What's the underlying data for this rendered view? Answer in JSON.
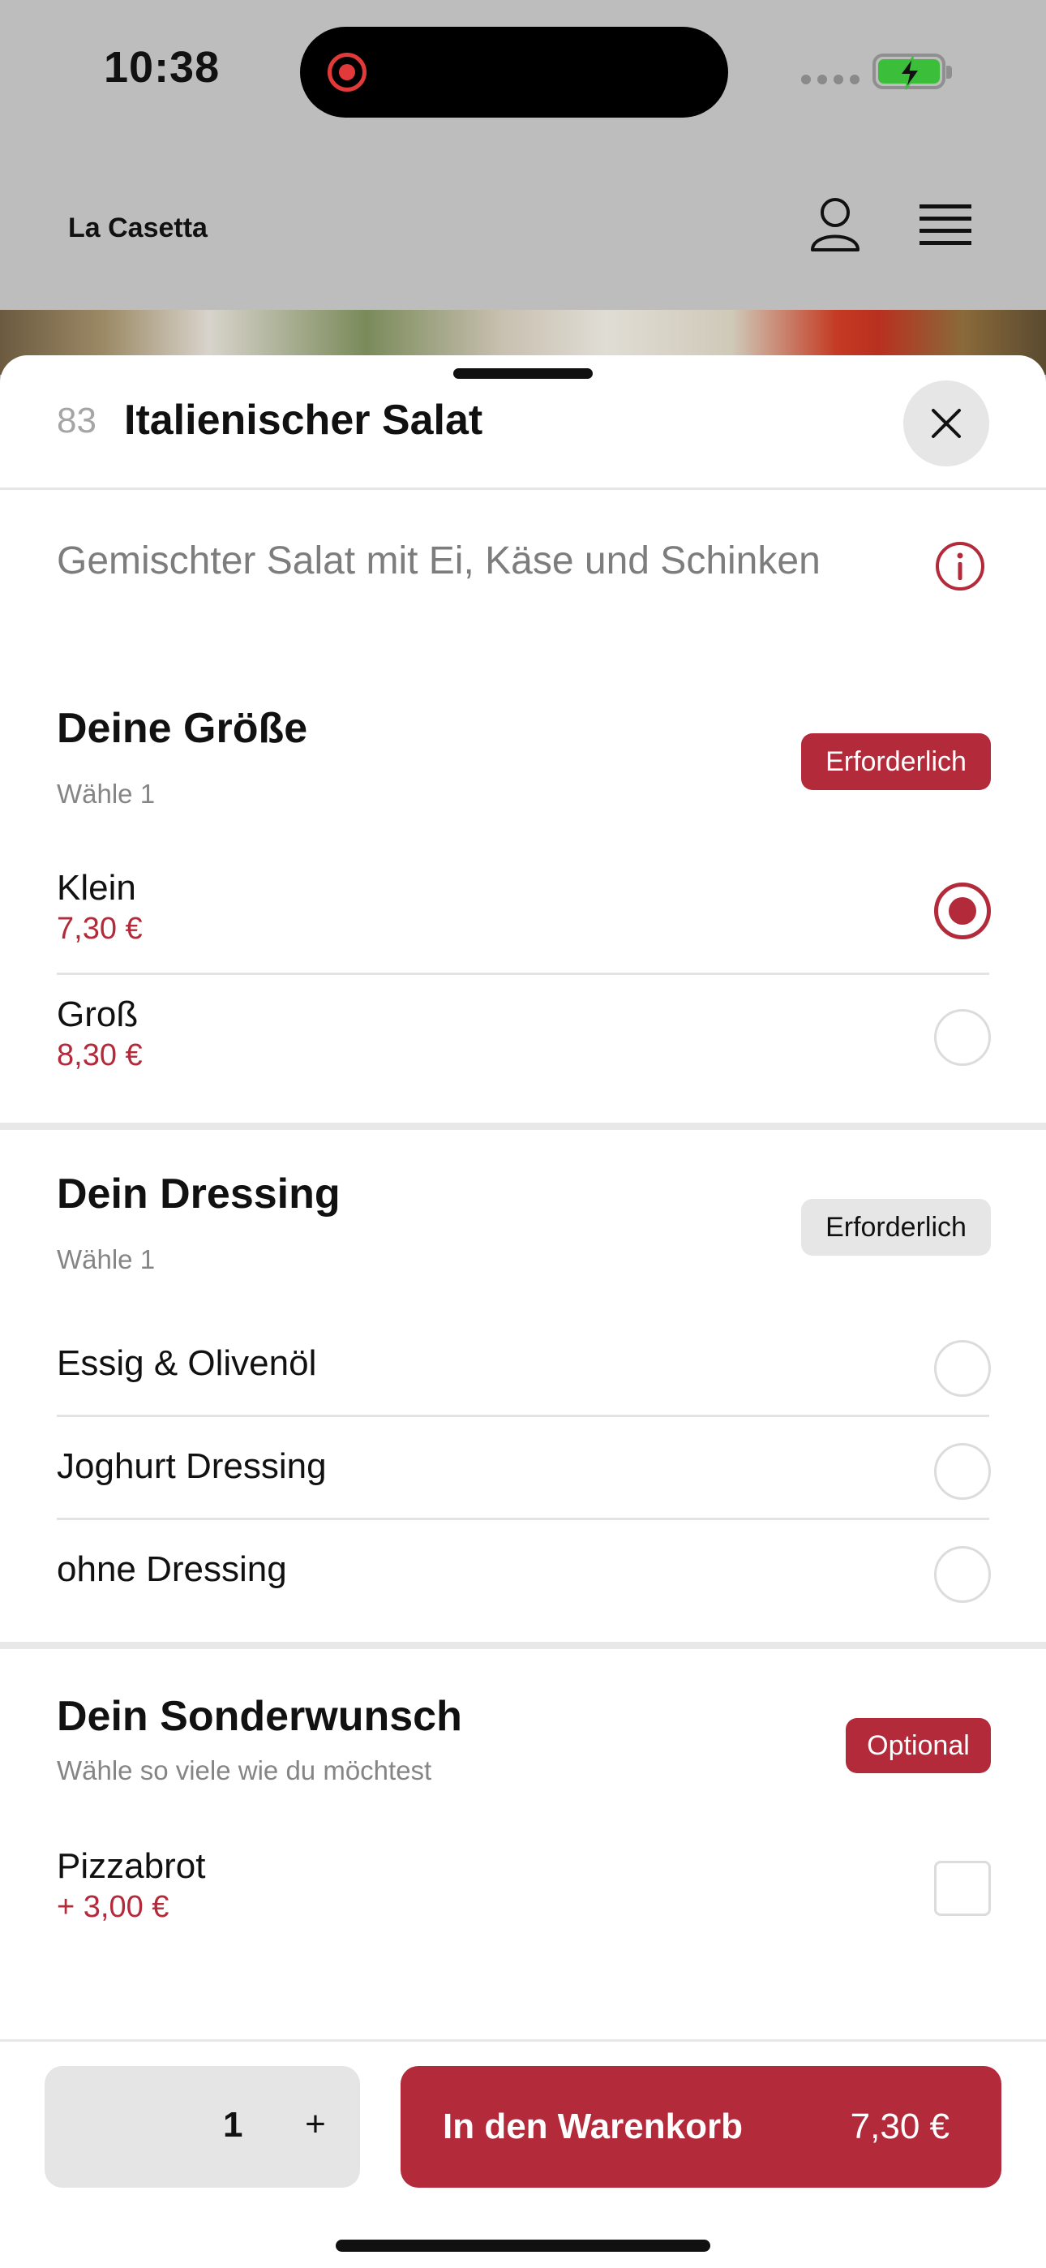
{
  "status_bar": {
    "time": "10:38"
  },
  "header": {
    "brand": "La Casetta"
  },
  "product": {
    "number": "83",
    "title": "Italienischer Salat",
    "description": "Gemischter Salat mit Ei, Käse und Schinken"
  },
  "sections": [
    {
      "title": "Deine Größe",
      "subtitle": "Wähle 1",
      "badge": "Erforderlich",
      "options": [
        {
          "label": "Klein",
          "price": "7,30 €",
          "selected": true
        },
        {
          "label": "Groß",
          "price": "8,30 €",
          "selected": false
        }
      ]
    },
    {
      "title": "Dein Dressing",
      "subtitle": "Wähle 1",
      "badge": "Erforderlich",
      "options": [
        {
          "label": "Essig & Olivenöl",
          "selected": false
        },
        {
          "label": "Joghurt Dressing",
          "selected": false
        },
        {
          "label": "ohne Dressing",
          "selected": false
        }
      ]
    },
    {
      "title": "Dein Sonderwunsch",
      "subtitle": "Wähle so viele wie du möchtest",
      "badge": "Optional",
      "options": [
        {
          "label": "Pizzabrot",
          "price": "+ 3,00 €",
          "checked": false
        }
      ]
    }
  ],
  "bottom_bar": {
    "quantity": "1",
    "plus": "+",
    "cart_label": "In den Warenkorb",
    "cart_price": "7,30 €"
  },
  "colors": {
    "accent": "#b32a3a",
    "header_bg": "#bdbdbd",
    "badge_grey": "#e6e6e6"
  }
}
